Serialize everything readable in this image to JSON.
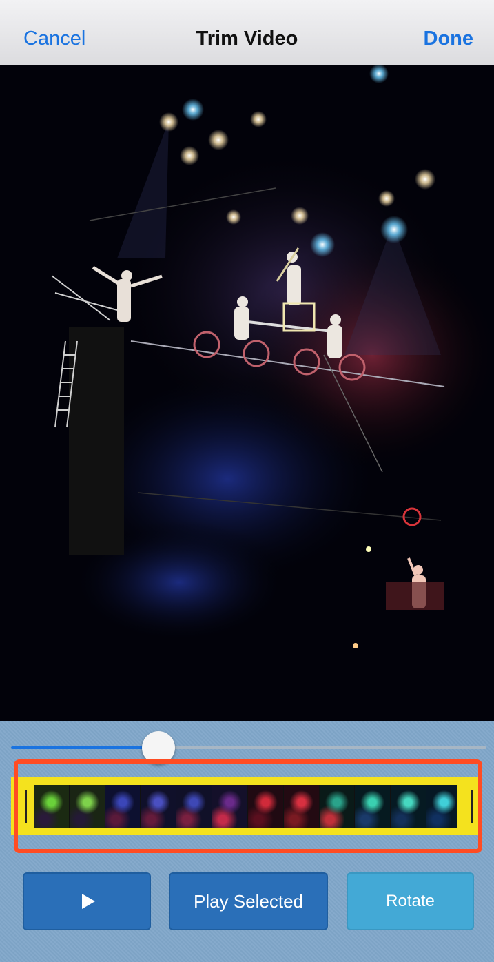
{
  "navbar": {
    "cancel_label": "Cancel",
    "title": "Trim Video",
    "done_label": "Done"
  },
  "video": {
    "scrubber_position_fraction": 0.31
  },
  "trim": {
    "start_fraction": 0.0,
    "end_fraction": 1.0,
    "filmstrip_frame_count": 12
  },
  "buttons": {
    "play_icon": "play-icon",
    "play_selected_label": "Play Selected",
    "rotate_label": "Rotate"
  },
  "colors": {
    "accent": "#1a73e0",
    "trim_frame": "#f4e21e",
    "highlight_outline": "#ff4c23",
    "button_primary": "#2a6fb8",
    "button_secondary": "#43a9d6",
    "panel_background": "#7fa6c9"
  }
}
